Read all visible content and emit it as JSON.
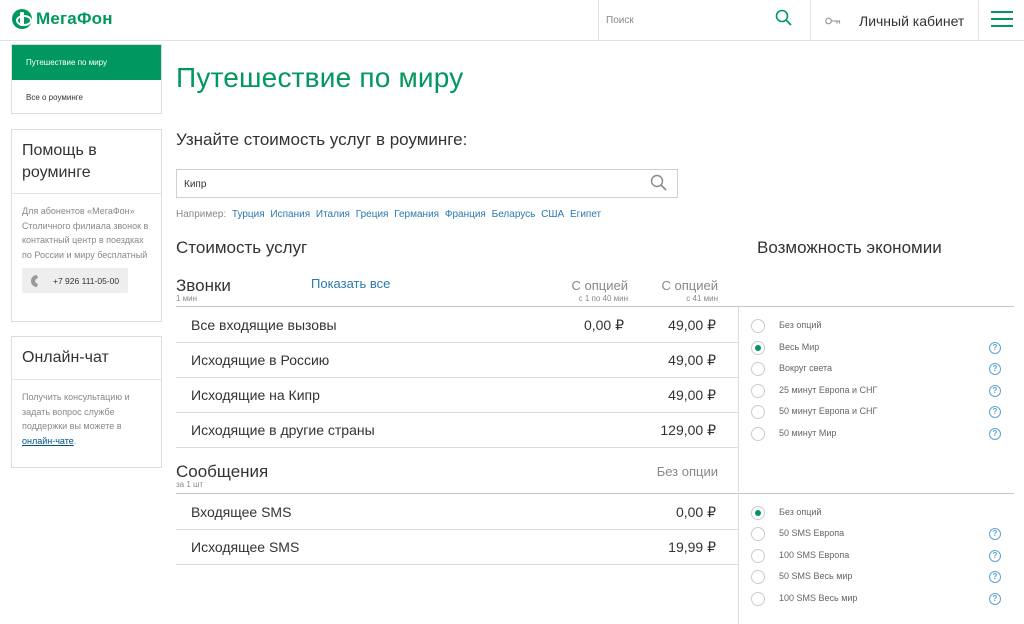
{
  "header": {
    "logo_text": "МегаФон",
    "search_placeholder": "Поиск",
    "cabinet_label": "Личный кабинет"
  },
  "sidebar": {
    "nav": [
      "Путешествие по миру",
      "Все о роуминге"
    ],
    "help_box": {
      "title": "Помощь в роуминге",
      "text": "Для абонентов «МегаФон» Столичного филиала звонок в контактный центр в поездках по России и миру бесплатный",
      "phone": "+7 926 111-05-00"
    },
    "chat_box": {
      "title": "Онлайн-чат",
      "text": "Получить консультацию и задать вопрос службе поддержки вы можете в",
      "link": "онлайн-чате",
      "text_end": "."
    }
  },
  "main": {
    "title": "Путешествие по миру",
    "subtitle": "Узнайте стоимость услуг в роуминге:",
    "country_value": "Кипр",
    "examples_label": "Например:",
    "examples": [
      "Турция",
      "Испания",
      "Италия",
      "Греция",
      "Германия",
      "Франция",
      "Беларусь",
      "США",
      "Египет"
    ],
    "costs_title": "Стоимость услуг",
    "savings_title": "Возможность экономии",
    "calls": {
      "title": "Звонки",
      "unit": "1 мин",
      "show_all": "Показать все",
      "col1": "С опцией",
      "col1_sub": "с 1 по 40 мин",
      "col2": "С опцией",
      "col2_sub": "с 41 мин",
      "rows": [
        {
          "label": "Все входящие вызовы",
          "v1": "0,00 ₽",
          "v2": "49,00 ₽"
        },
        {
          "label": "Исходящие в Россию",
          "v1": "",
          "v2": "49,00 ₽"
        },
        {
          "label": "Исходящие на Кипр",
          "v1": "",
          "v2": "49,00 ₽"
        },
        {
          "label": "Исходящие в другие страны",
          "v1": "",
          "v2": "129,00 ₽"
        }
      ],
      "options": [
        {
          "label": "Без опций",
          "selected": false,
          "help": false
        },
        {
          "label": "Весь Мир",
          "selected": true,
          "help": true
        },
        {
          "label": "Вокруг света",
          "selected": false,
          "help": true
        },
        {
          "label": "25 минут Европа и СНГ",
          "selected": false,
          "help": true
        },
        {
          "label": "50 минут Европа и СНГ",
          "selected": false,
          "help": true
        },
        {
          "label": "50 минут Мир",
          "selected": false,
          "help": true
        }
      ]
    },
    "messages": {
      "title": "Сообщения",
      "unit": "за 1 шт",
      "col": "Без опции",
      "rows": [
        {
          "label": "Входящее SMS",
          "v": "0,00 ₽"
        },
        {
          "label": "Исходящее SMS",
          "v": "19,99 ₽"
        }
      ],
      "options": [
        {
          "label": "Без опций",
          "selected": true,
          "help": false
        },
        {
          "label": "50 SMS Европа",
          "selected": false,
          "help": true
        },
        {
          "label": "100 SMS Европа",
          "selected": false,
          "help": true
        },
        {
          "label": "50 SMS Весь мир",
          "selected": false,
          "help": true
        },
        {
          "label": "100 SMS Весь мир",
          "selected": false,
          "help": true
        }
      ]
    },
    "help_glyph": "?"
  },
  "colors": {
    "brand": "#00985f",
    "link": "#2a7ab0"
  }
}
